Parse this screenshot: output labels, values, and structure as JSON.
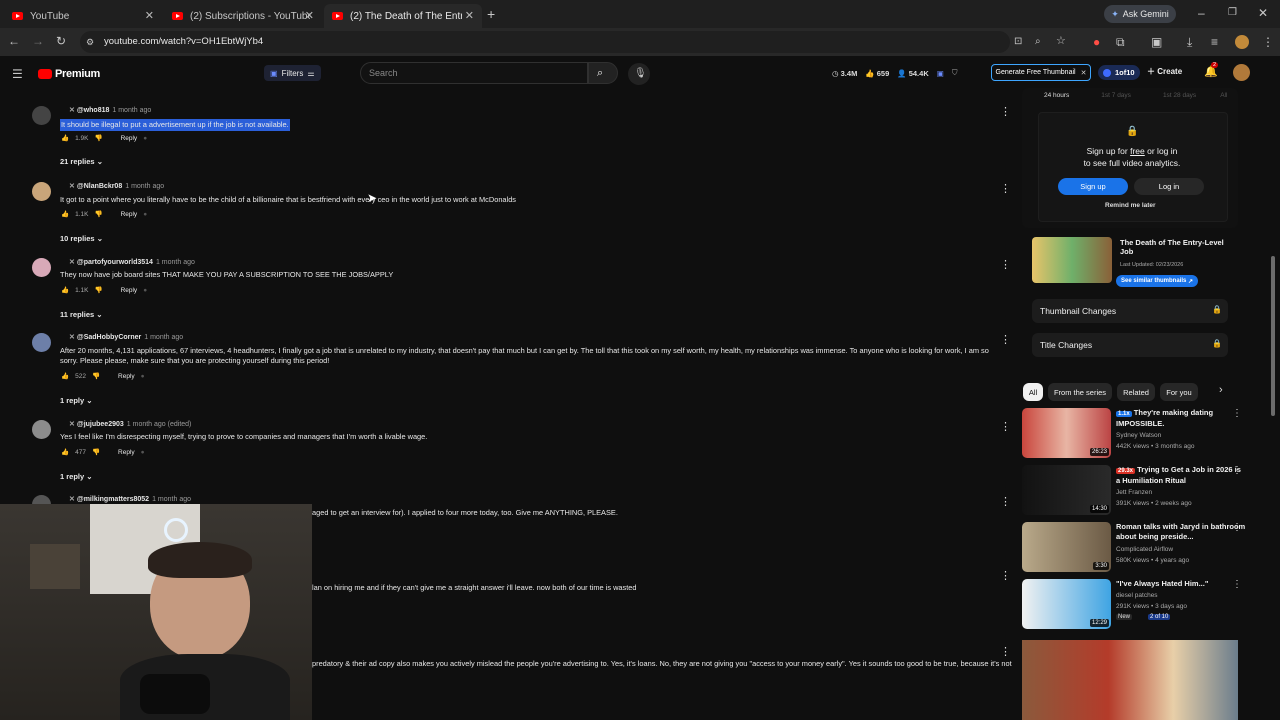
{
  "browser": {
    "tabs": [
      {
        "title": "YouTube",
        "active": false
      },
      {
        "title": "(2) Subscriptions - YouTube",
        "active": false
      },
      {
        "title": "(2) The Death of The Entry-Leve",
        "active": true
      }
    ],
    "new_tab": "+",
    "ask_gemini": "Ask Gemini",
    "url": "youtube.com/watch?v=OH1EbtWjYb4"
  },
  "header": {
    "logo": "Premium",
    "filters_label": "Filters",
    "search_placeholder": "Search",
    "stats": {
      "views": "3.4M",
      "likes": "659",
      "subs": "54.4K"
    },
    "generate_thumbnail": "Generate Free Thumbnail",
    "test_badge": "1of10",
    "create": "Create",
    "notif_count": "2"
  },
  "comments": [
    {
      "user": "@who818",
      "when": "1 month ago",
      "text": "It should be illegal to put a advertisement up if the job is not available.",
      "likes": "1.9K",
      "reply": "Reply",
      "replies": "21 replies",
      "highlight": true
    },
    {
      "user": "@NlanBckr08",
      "when": "1 month ago",
      "text": "It got to a point where you literally have to be the child of a billionaire that is bestfriend with every ceo in the world just to work at McDonalds",
      "likes": "1.1K",
      "reply": "Reply",
      "replies": "10 replies"
    },
    {
      "user": "@partofyourworld3514",
      "when": "1 month ago",
      "text": "They now have job board sites THAT MAKE YOU PAY A SUBSCRIPTION TO SEE THE JOBS/APPLY",
      "likes": "1.1K",
      "reply": "Reply",
      "replies": "11 replies"
    },
    {
      "user": "@SadHobbyCorner",
      "when": "1 month ago",
      "text": "After 20 months, 4,131 applications, 67 interviews, 4 headhunters, I finally got a job that is unrelated to my industry, that doesn't pay that much but I can get by. The toll that this took on my self worth, my health, my relationships was immense. To anyone who is looking for work, I am so sorry. Please please, make sure that you are protecting yourself during this period!",
      "likes": "522",
      "reply": "Reply",
      "replies": "1 reply"
    },
    {
      "user": "@jujubee2903",
      "when": "1 month ago (edited)",
      "text": "Yes I feel like I'm disrespecting myself, trying to prove to companies and managers that I'm worth a livable wage.",
      "likes": "477",
      "reply": "Reply",
      "replies": "1 reply"
    },
    {
      "user": "@milkingmatters8052",
      "when": "1 month ago",
      "text": "aged to get an interview for). I applied to four more today, too. Give me ANYTHING, PLEASE."
    }
  ],
  "partial_texts": [
    "lan on hiring me and if they can't give me a straight answer i'll leave. now both of our time is wasted",
    "predatory & their ad copy also makes you actively mislead the people you're advertising to. Yes, it's loans. No, they are not giving you \"access to your money early\". Yes it sounds too good to be true, because it's not"
  ],
  "sidebar": {
    "analytics_tabs": [
      "24 hours",
      "1st 7 days",
      "1st 28 days",
      "All"
    ],
    "signup_text_1": "Sign up for",
    "signup_free": "free",
    "signup_text_2": "or log in",
    "signup_text_3": "to see full video analytics.",
    "signup_btn": "Sign up",
    "login_btn": "Log in",
    "remind": "Remind me later",
    "video_title": "The Death of The Entry-Level Job",
    "last_updated": "Last Updated: 02/23/2026",
    "similar_btn": "See similar thumbnails",
    "thumbnail_changes": "Thumbnail Changes",
    "title_changes": "Title Changes",
    "chips": [
      "All",
      "From the series",
      "Related",
      "For you"
    ]
  },
  "recommendations": [
    {
      "badge": "1.1x",
      "title": "They're making dating IMPOSSIBLE.",
      "channel": "Sydney Watson",
      "meta": "442K views • 3 months ago",
      "duration": "26:23"
    },
    {
      "badge": "29.3x",
      "title": "Trying to Get a Job in 2026 is a Humiliation Ritual",
      "channel": "Jett Franzen",
      "meta": "391K views • 2 weeks ago",
      "duration": "14:30"
    },
    {
      "badge": "",
      "title": "Roman talks with Jaryd in bathroom about being preside...",
      "channel": "Complicated Airflow",
      "meta": "580K views • 4 years ago",
      "duration": "3:30"
    },
    {
      "badge": "",
      "title": "\"I've Always Hated Him...\"",
      "channel": "diesel patches",
      "meta": "291K views • 3 days ago",
      "duration": "12:29",
      "new": "New",
      "series": "2 of 10"
    }
  ],
  "colors": {
    "accent": "#3ea6ff",
    "red": "#ff0000",
    "highlight": "#2b5fd9"
  }
}
